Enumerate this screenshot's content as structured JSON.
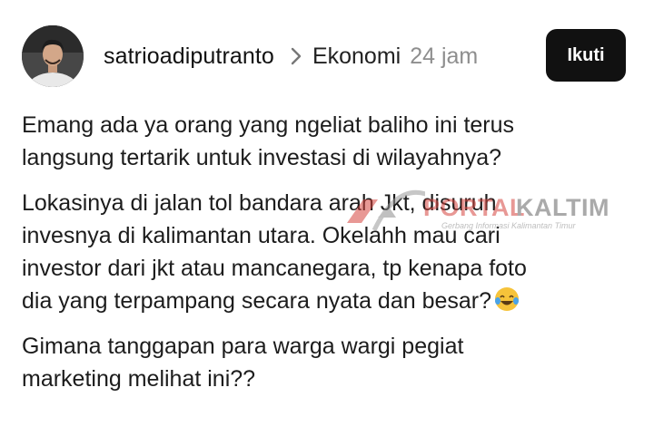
{
  "header": {
    "username": "satrioadiputranto",
    "topic": "Ekonomi",
    "time": "24 jam",
    "follow_label": "Ikuti"
  },
  "post": {
    "paragraphs": [
      [
        "Emang ada ya orang yang ngeliat baliho ini terus",
        "langsung tertarik untuk investasi di wilayahnya?"
      ],
      [
        "Lokasinya di jalan tol bandara arah Jkt, disuruh",
        "invesnya di kalimantan utara. Okelahh mau cari",
        "investor dari jkt atau mancanegara, tp kenapa foto",
        "dia yang terpampang secara nyata dan besar?"
      ],
      [
        "Gimana tanggapan para warga wargi pegiat",
        "marketing melihat ini??"
      ]
    ]
  },
  "watermark": {
    "brand_left": "PORTAL",
    "brand_right": "KALTIM",
    "tagline": "Gerbang Informasi Kalimantan Timur"
  },
  "icons": {
    "chevron": "chevron-right-icon",
    "emoji": "face-with-tears-of-joy-emoji"
  },
  "colors": {
    "button_bg": "#111111",
    "timestamp": "#8e8e8e",
    "watermark_red": "#d6453f"
  }
}
